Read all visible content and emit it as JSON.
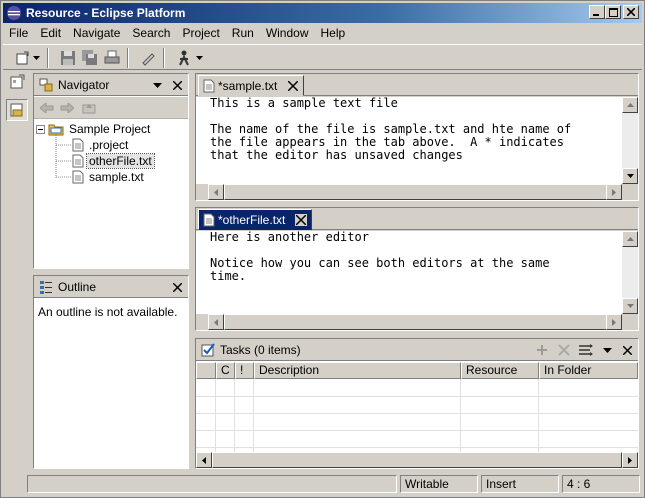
{
  "window": {
    "title": "Resource - Eclipse Platform"
  },
  "menu": [
    "File",
    "Edit",
    "Navigate",
    "Search",
    "Project",
    "Run",
    "Window",
    "Help"
  ],
  "navigator": {
    "title": "Navigator",
    "tree": [
      {
        "label": "Sample Project",
        "type": "project"
      },
      {
        "label": ".project",
        "type": "file"
      },
      {
        "label": "otherFile.txt",
        "type": "file",
        "selected": true
      },
      {
        "label": "sample.txt",
        "type": "file"
      }
    ]
  },
  "outline": {
    "title": "Outline",
    "message": "An outline is not available."
  },
  "editors": [
    {
      "tab": "*sample.txt",
      "active": false,
      "lines": [
        "This is a sample text file",
        "",
        "The name of the file is sample.txt and hte name of",
        "the file appears in the tab above.  A * indicates",
        "that the editor has unsaved changes"
      ]
    },
    {
      "tab": "*otherFile.txt",
      "active": true,
      "lines": [
        "Here is another editor",
        "",
        "Notice how you can see both editors at the same",
        "time."
      ]
    }
  ],
  "tasks": {
    "title": "Tasks (0 items)",
    "columns": [
      "C",
      "!",
      "Description",
      "Resource",
      "In Folder"
    ]
  },
  "status": {
    "mode": "Writable",
    "insert": "Insert",
    "position": "4 : 6"
  },
  "colors": {
    "titlebar": "#0a246a",
    "chrome": "#d4d0c8",
    "active_tab": "#0a246a"
  }
}
